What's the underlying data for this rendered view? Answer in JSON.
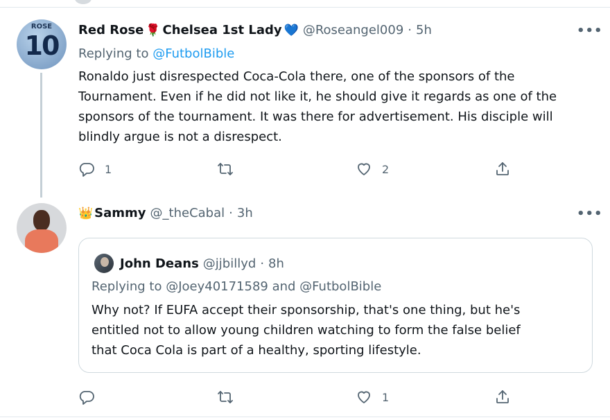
{
  "tweet1": {
    "avatar_text_top": "ROSE",
    "avatar_text_num": "10",
    "name": "Red Rose",
    "name_mid": "Chelsea 1st Lady",
    "rose_emoji": "🌹",
    "heart_emoji": "💙",
    "handle": "@Roseangel009",
    "sep": "·",
    "time": "5h",
    "replying_prefix": "Replying to",
    "replying_to": "@FutbolBible",
    "body_lines": [
      "Ronaldo just disrespected Coca-Cola there, one of the sponsors of the",
      "Tournament. Even if he did not like it, he should give it regards as one of the",
      "sponsors of the tournament. It was there for advertisement. His disciple will",
      "blindly argue is not a disrespect."
    ],
    "reply_count": "1",
    "retweet_count": "",
    "like_count": "2",
    "more": "•••"
  },
  "tweet2": {
    "crown_emoji": "👑",
    "name": "Sammy",
    "handle": "@_theCabal",
    "sep": "·",
    "time": "3h",
    "more": "•••",
    "like_count": "1",
    "quote": {
      "name": "John Deans",
      "handle": "@jjbillyd",
      "sep": "·",
      "time": "8h",
      "replying": "Replying to @Joey40171589 and @FutbolBible",
      "body_lines": [
        "Why not? If EUFA accept their sponsorship, that's one thing, but he's",
        "entitled not to allow young children watching to form the false belief",
        "that Coca Cola is part of a healthy, sporting lifestyle."
      ]
    }
  },
  "icons": [
    "reply-icon",
    "retweet-icon",
    "like-icon",
    "share-icon"
  ]
}
